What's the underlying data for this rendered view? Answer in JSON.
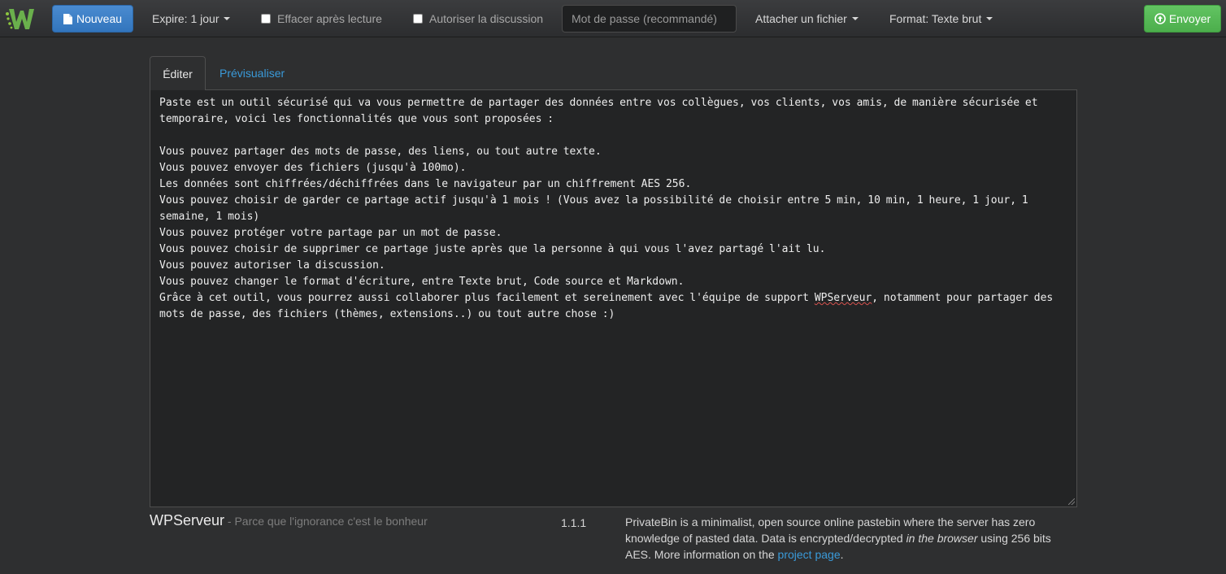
{
  "navbar": {
    "new_button": "Nouveau",
    "expire": "Expire: 1 jour",
    "burn_after_reading": "Effacer après lecture",
    "open_discussion": "Autoriser la discussion",
    "password_placeholder": "Mot de passe (recommandé)",
    "attach": "Attacher un fichier",
    "format": "Format: Texte brut",
    "send_button": "Envoyer",
    "accent_colors": {
      "new": "#3c80c6",
      "send": "#5cb85c",
      "logo": "#6ab04c"
    }
  },
  "tabs": {
    "edit": "Éditer",
    "preview": "Prévisualiser"
  },
  "editor": {
    "lines": [
      "Paste est un outil sécurisé qui va vous permettre de partager des données entre vos collègues, vos clients, vos amis, de manière sécurisée et temporaire, voici les fonctionnalités que vous sont proposées :",
      "",
      "Vous pouvez partager des mots de passe, des liens, ou tout autre texte.",
      "Vous pouvez envoyer des fichiers (jusqu'à 100mo).",
      "Les données sont chiffrées/déchiffrées dans le navigateur par un chiffrement AES 256.",
      "Vous pouvez choisir de garder ce partage actif jusqu'à 1 mois ! (Vous avez la possibilité de choisir entre 5 min, 10 min, 1 heure, 1 jour, 1 semaine, 1 mois)",
      "Vous pouvez protéger votre partage par un mot de passe.",
      "Vous pouvez choisir de supprimer ce partage juste après que la personne à qui vous l'avez partagé l'ait lu.",
      "Vous pouvez autoriser la discussion.",
      "Vous pouvez changer le format d'écriture, entre Texte brut, Code source et Markdown."
    ],
    "last_line_before": "Grâce à cet outil, vous pourrez aussi collaborer plus facilement et sereinement avec l'équipe de support ",
    "last_line_word": "WPServeur",
    "last_line_after": ", notamment pour partager des mots de passe, des fichiers (thèmes, extensions..) ou tout autre chose :)"
  },
  "footer": {
    "brand": "WPServeur",
    "tagline": " - Parce que l'ignorance c'est le bonheur",
    "version": "1.1.1",
    "about_1": "PrivateBin is a minimalist, open source online pastebin where the server has zero knowledge of pasted data. Data is encrypted/decrypted ",
    "about_em": "in the browser",
    "about_2": " using 256 bits AES. More information on the ",
    "about_link": "project page",
    "about_end": "."
  }
}
